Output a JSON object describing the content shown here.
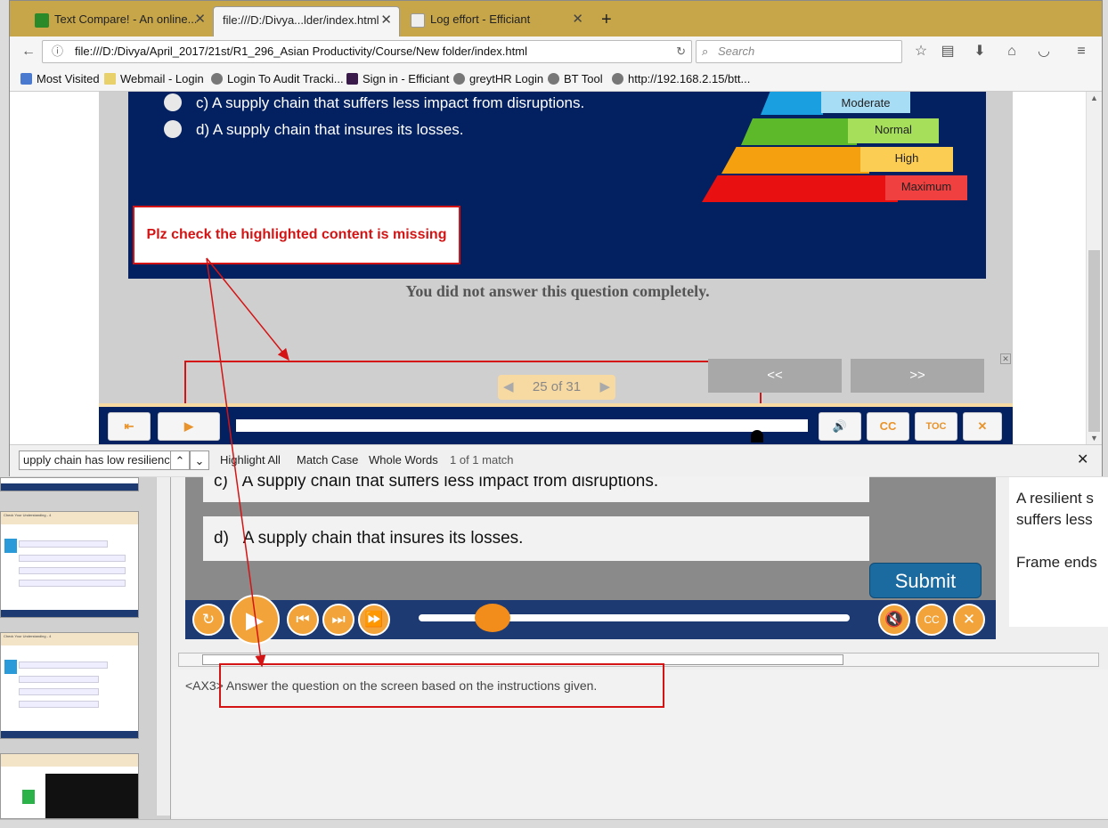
{
  "browser": {
    "tabs": [
      {
        "label": "Text Compare! - An online...",
        "favicon": "text-compare-icon"
      },
      {
        "label": "file:///D:/Divya...lder/index.html",
        "favicon": "page-icon"
      },
      {
        "label": "Log effort - Efficiant",
        "favicon": "page-icon"
      }
    ],
    "new_tab": "+",
    "url": "file:///D:/Divya/April_2017/21st/R1_296_Asian Productivity/Course/New folder/index.html",
    "search_placeholder": "Search",
    "bookmarks": [
      "Most Visited",
      "Webmail - Login",
      "Login To Audit Tracki...",
      "Sign in - Efficiant",
      "greytHR Login",
      "BT Tool",
      "http://192.168.2.15/btt..."
    ],
    "find": {
      "query": "upply chain has low resilience",
      "highlight_all": "Highlight All",
      "match_case": "Match Case",
      "whole_words": "Whole Words",
      "result": "1 of 1 match"
    }
  },
  "slide": {
    "options": [
      {
        "letter": "c)",
        "text": "A supply chain that suffers less impact from disruptions."
      },
      {
        "letter": "d)",
        "text": "A supply chain that insures its losses."
      }
    ],
    "pyramid": [
      "Moderate",
      "Normal",
      "High",
      "Maximum"
    ],
    "feedback": "You did not answer this question completely.",
    "pager": "25 of 31",
    "prev": "<<",
    "next": ">>",
    "controls": {
      "cc": "CC",
      "toc": "TOC"
    },
    "progress_fraction": 0.91
  },
  "annotation": {
    "note": "Plz check the highlighted content is missing"
  },
  "editor": {
    "answers": [
      {
        "letter": "c)",
        "text": "A supply chain that suffers less impact from disruptions."
      },
      {
        "letter": "d)",
        "text": "A supply chain that insures its losses."
      }
    ],
    "submit": "Submit",
    "right_panel": [
      "A resilient s",
      "suffers less",
      "Frame ends"
    ],
    "notes_text": "<AX3> Answer the question on the screen based on the instructions given.",
    "thumb_title": "Check Your Understanding - 4",
    "slider_fraction": 0.13
  },
  "colors": {
    "slide_blue": "#032060",
    "accent_orange": "#f2a33a",
    "annotation_red": "#d41414",
    "tabstrip": "#c7a64a"
  }
}
